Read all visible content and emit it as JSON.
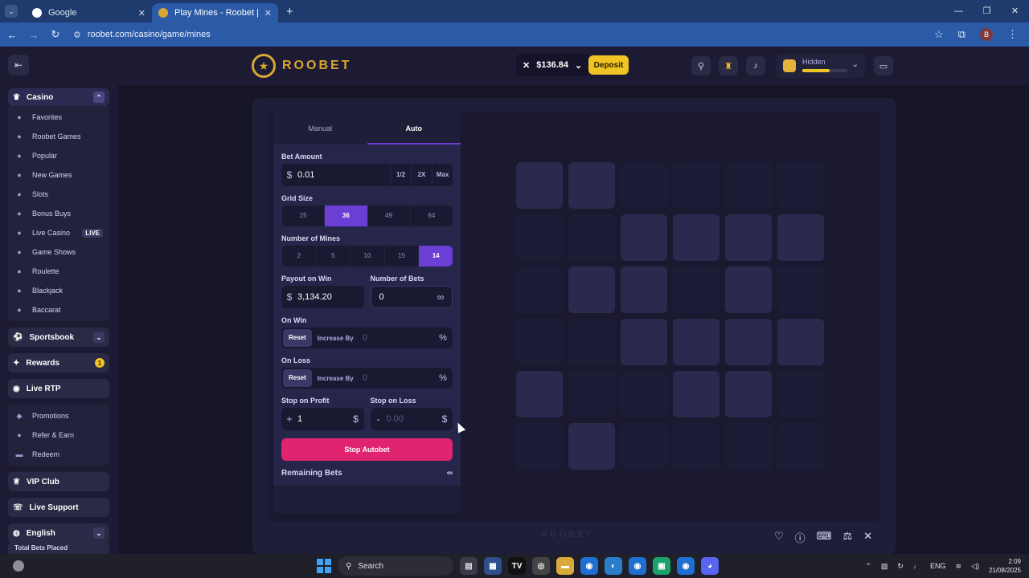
{
  "browser": {
    "tabs": [
      {
        "title": "Google",
        "active": false
      },
      {
        "title": "Play Mines - Roobet | Best Cryp",
        "active": true
      }
    ],
    "url": "roobet.com/casino/game/mines",
    "profile_initial": "B"
  },
  "header": {
    "logo_text": "ROOBET",
    "balance": "$136.84",
    "deposit_label": "Deposit",
    "vip_label": "Hidden",
    "vip_progress": 0.6
  },
  "sidebar": {
    "casino": {
      "label": "Casino",
      "items": [
        {
          "label": "Favorites",
          "icon": "heart-icon"
        },
        {
          "label": "Roobet Games",
          "icon": "roo-icon"
        },
        {
          "label": "Popular",
          "icon": "fire-icon"
        },
        {
          "label": "New Games",
          "icon": "star-icon"
        },
        {
          "label": "Slots",
          "icon": "slots-icon"
        },
        {
          "label": "Bonus Buys",
          "icon": "bonus-icon"
        },
        {
          "label": "Live Casino",
          "icon": "live-icon",
          "badge": "LIVE"
        },
        {
          "label": "Game Shows",
          "icon": "tv-icon"
        },
        {
          "label": "Roulette",
          "icon": "roulette-icon"
        },
        {
          "label": "Blackjack",
          "icon": "spade-icon"
        },
        {
          "label": "Baccarat",
          "icon": "club-icon"
        }
      ]
    },
    "sportsbook": "Sportsbook",
    "rewards": {
      "label": "Rewards",
      "badge": "1"
    },
    "live_rtp": "Live RTP",
    "promos": [
      {
        "label": "Promotions"
      },
      {
        "label": "Refer & Earn"
      },
      {
        "label": "Redeem"
      }
    ],
    "vip_club": "VIP Club",
    "live_support": "Live Support",
    "language": "English",
    "total_bets": "Total Bets Placed"
  },
  "panel": {
    "tabs": [
      "Manual",
      "Auto"
    ],
    "active_tab": "Auto",
    "bet_amount_label": "Bet Amount",
    "bet_amount": "0.01",
    "bet_buttons": [
      "1/2",
      "2X",
      "Max"
    ],
    "grid_size_label": "Grid Size",
    "grid_sizes": [
      "25",
      "36",
      "49",
      "64"
    ],
    "grid_size_selected": "36",
    "mines_label": "Number of Mines",
    "mines_options": [
      "2",
      "5",
      "10",
      "15",
      "14"
    ],
    "mines_selected": "14",
    "payout_label": "Payout on Win",
    "payout_value": "3,134.20",
    "num_bets_label": "Number of Bets",
    "num_bets_value": "0",
    "on_win_label": "On Win",
    "on_loss_label": "On Loss",
    "reset_label": "Reset",
    "increase_label": "Increase By",
    "on_win_value": "0",
    "on_loss_value": "0",
    "stop_profit_label": "Stop on Profit",
    "stop_profit_value": "1",
    "stop_loss_label": "Stop on Loss",
    "stop_loss_placeholder": "0.00",
    "stop_button": "Stop Autobet",
    "remaining_label": "Remaining Bets",
    "remaining_value": "∞"
  },
  "grid_tiles": [
    1,
    1,
    0,
    0,
    0,
    0,
    0,
    0,
    1,
    1,
    1,
    1,
    0,
    1,
    1,
    0,
    1,
    0,
    0,
    0,
    1,
    1,
    1,
    1,
    1,
    0,
    0,
    1,
    1,
    0,
    0,
    1,
    0,
    0,
    0,
    0
  ],
  "footer": {
    "logo_text": "ROOBET"
  },
  "taskbar": {
    "search": "Search",
    "lang": "ENG",
    "time": "2:09",
    "date": "21/08/2025"
  },
  "colors": {
    "accent": "#6b3ed6",
    "deposit": "#f0c425",
    "stop": "#e1246f"
  }
}
